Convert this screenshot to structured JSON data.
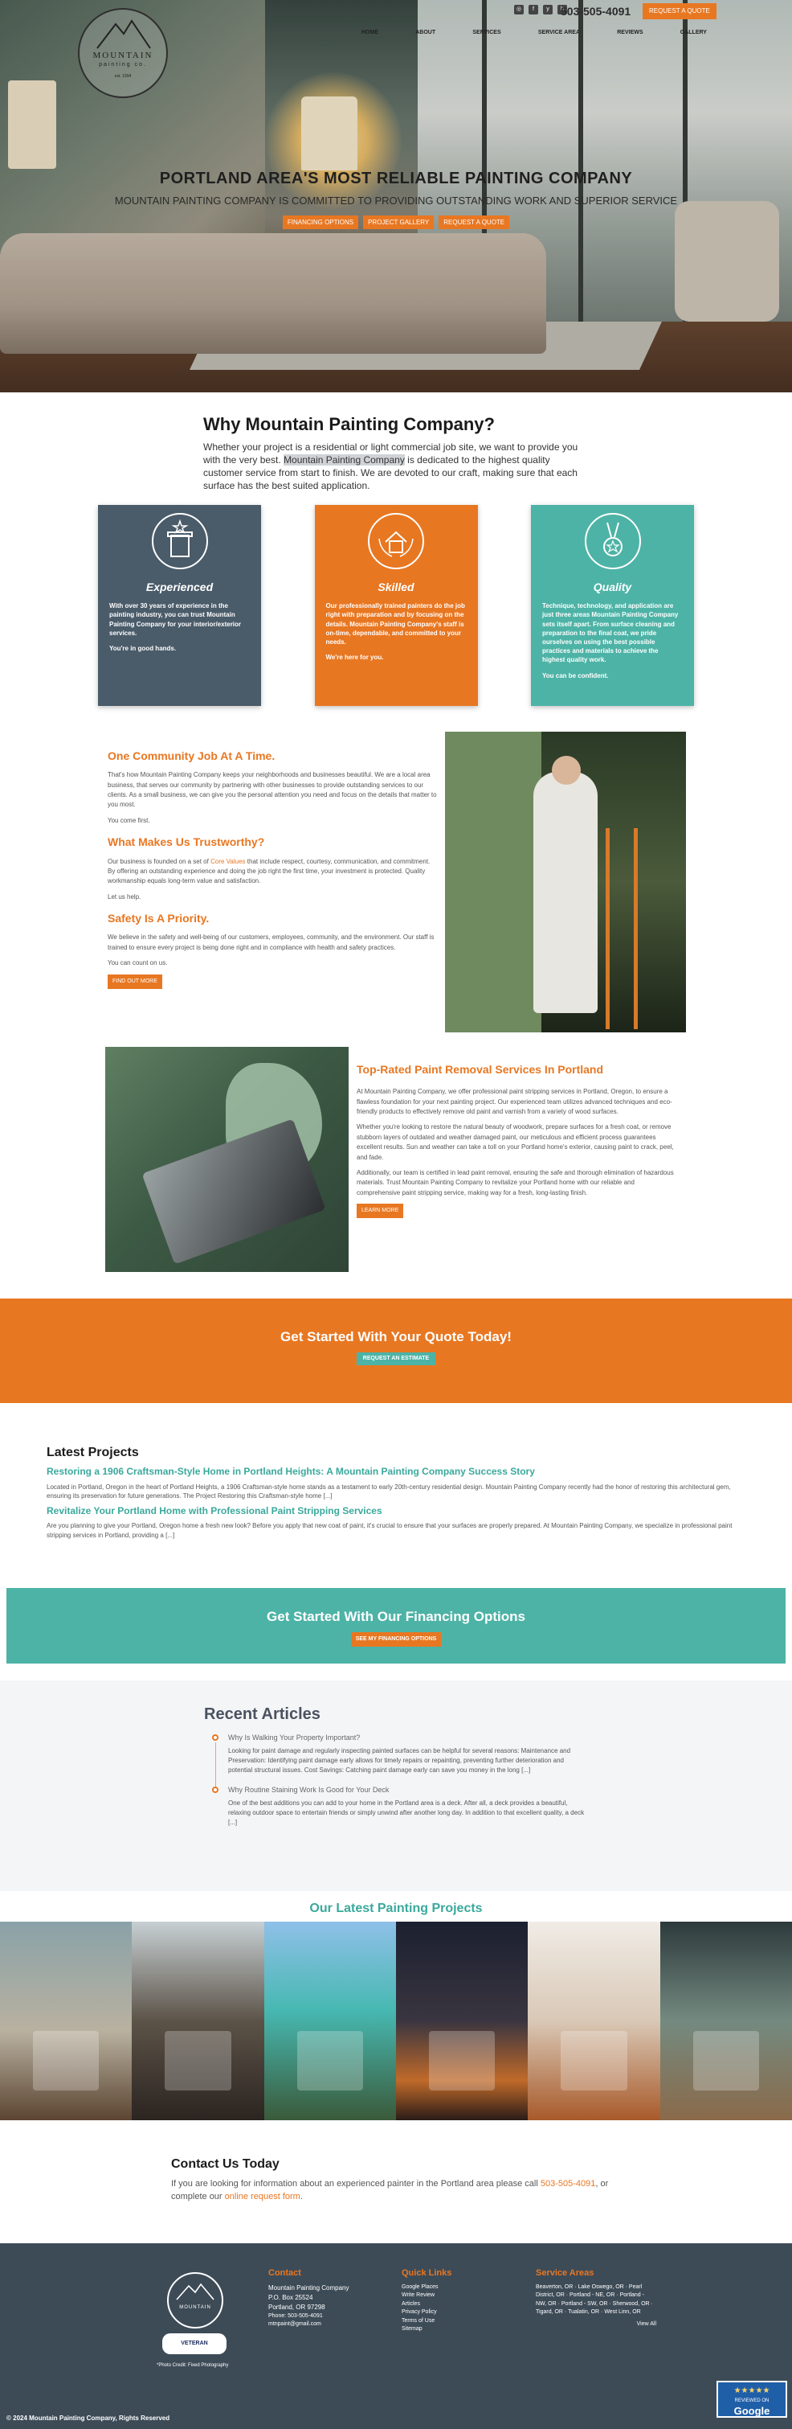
{
  "header": {
    "logo_name": "MOUNTAIN",
    "logo_sub": "painting co.",
    "logo_est": "est. 1994",
    "phone": "503-505-4091",
    "quote_button": "REQUEST A QUOTE",
    "social": [
      "instagram-icon",
      "facebook-icon",
      "yelp-icon",
      "houzz-icon"
    ],
    "nav": [
      "HOME",
      "ABOUT",
      "SERVICES",
      "SERVICE AREA",
      "REVIEWS",
      "GALLERY"
    ]
  },
  "hero": {
    "title": "PORTLAND AREA'S MOST RELIABLE PAINTING COMPANY",
    "subtitle": "MOUNTAIN PAINTING COMPANY IS COMMITTED TO PROVIDING OUTSTANDING WORK AND SUPERIOR SERVICE",
    "buttons": [
      "FINANCING OPTIONS",
      "PROJECT GALLERY",
      "REQUEST A QUOTE"
    ]
  },
  "why": {
    "title": "Why Mountain Painting Company?",
    "text_before": "Whether your project is a residential or light commercial job site, we want to provide you with the very best.",
    "highlight": "Mountain Painting Company",
    "text_after": "is dedicated to the highest quality customer service from start to finish. We are devoted to our craft, making sure that each surface has the best suited application."
  },
  "cards": [
    {
      "title": "Experienced",
      "icon": "pillar-icon",
      "p1": "With over 30 years of experience in the painting industry, you can trust Mountain Painting Company for your interior/exterior services.",
      "p2": "You're in good hands."
    },
    {
      "title": "Skilled",
      "icon": "house-laurel-icon",
      "p1": "Our professionally trained painters do the job right with preparation and by focusing on the details. Mountain Painting Company's staff is on-time, dependable, and committed to your needs.",
      "p2": "We're here for you."
    },
    {
      "title": "Quality",
      "icon": "medal-icon",
      "p1": "Technique, technology, and application are just three areas Mountain Painting Company sets itself apart. From surface cleaning and preparation to the final coat, we pride ourselves on using the best possible practices and materials to achieve the highest quality work.",
      "p2": "You can be confident."
    }
  ],
  "community": {
    "h1": "One Community Job At A Time.",
    "p1": "That's how Mountain Painting Company keeps your neighborhoods and businesses beautiful. We are a local area business, that serves our community by partnering with other businesses to provide outstanding services to our clients. As a small business, we can give you the personal attention you need and focus on the details that matter to you most.",
    "p1b": "You come first.",
    "h2": "What Makes Us Trustworthy?",
    "p2_before": "Our business is founded on a set of",
    "p2_link": "Core Values",
    "p2_after": "that include respect, courtesy, communication, and commitment. By offering an outstanding experience and doing the job right the first time, your investment is protected. Quality workmanship equals long-term value and satisfaction.",
    "p2b": "Let us help.",
    "h3": "Safety Is A Priority.",
    "p3": "We believe in the safety and well-being of our customers, employees, community, and the environment. Our staff is trained to ensure every project is being done right and in compliance with health and safety practices.",
    "p3b": "You can count on us.",
    "button": "FIND OUT MORE"
  },
  "removal": {
    "title": "Top-Rated Paint Removal Services In Portland",
    "p1": "At Mountain Painting Company, we offer professional paint stripping services in Portland, Oregon, to ensure a flawless foundation for your next painting project. Our experienced team utilizes advanced techniques and eco-friendly products to effectively remove old paint and varnish from a variety of wood surfaces.",
    "p2": "Whether you're looking to restore the natural beauty of woodwork, prepare surfaces for a fresh coat, or remove stubborn layers of outdated and weather damaged paint, our meticulous and efficient process guarantees excellent results. Sun and weather can take a toll on your Portland home's exterior, causing paint to crack, peel, and fade.",
    "p3": "Additionally, our team is certified in lead paint removal, ensuring the safe and thorough elimination of hazardous materials. Trust Mountain Painting Company to revitalize your Portland home with our reliable and comprehensive paint stripping service, making way for a fresh, long-lasting finish.",
    "button": "LEARN MORE"
  },
  "quote_band": {
    "title": "Get Started With Your Quote Today!",
    "button": "REQUEST AN ESTIMATE"
  },
  "latest": {
    "title": "Latest Projects",
    "items": [
      {
        "title": "Restoring a 1906 Craftsman-Style Home in Portland Heights: A Mountain Painting Company Success Story",
        "text": "Located in Portland, Oregon in the heart of Portland Heights, a 1906 Craftsman-style home stands as a testament to early 20th-century residential design. Mountain Painting Company recently had the honor of restoring this architectural gem, ensuring its preservation for future generations. The Project Restoring this Craftsman-style home [...]"
      },
      {
        "title": "Revitalize Your Portland Home with Professional Paint Stripping Services",
        "text": "Are you planning to give your Portland, Oregon home a fresh new look? Before you apply that new coat of paint, it's crucial to ensure that your surfaces are properly prepared. At Mountain Painting Company, we specialize in professional paint stripping services in Portland, providing a [...]"
      }
    ]
  },
  "financing": {
    "title": "Get Started With Our Financing Options",
    "button": "SEE MY FINANCING OPTIONS"
  },
  "recent": {
    "title": "Recent Articles",
    "items": [
      {
        "title": "Why Is Walking Your Property Important?",
        "text": "Looking for paint damage and regularly inspecting painted surfaces can be helpful for several reasons: Maintenance and Preservation: Identifying paint damage early allows for timely repairs or repainting, preventing further deterioration and potential structural issues. Cost Savings: Catching paint damage early can save you money in the long [...]"
      },
      {
        "title": "Why Routine Staining Work Is Good for Your Deck",
        "text": "One of the best additions you can add to your home in the Portland area is a deck. After all, a deck provides a beautiful, relaxing outdoor space to entertain friends or simply unwind after another long day. In addition to that excellent quality, a deck [...]"
      }
    ]
  },
  "gallery_title": "Our Latest Painting Projects",
  "contact": {
    "title": "Contact Us Today",
    "text1": "If you are looking for information about an experienced painter in the Portland area please call",
    "phone": "503-505-4091",
    "text2": ", or complete our",
    "link": "online request form",
    "text3": "."
  },
  "footer": {
    "logo_name": "MOUNTAIN",
    "veteran": "VETERAN",
    "photo_credit": "*Photo Credit: Fixed Photography",
    "contact_h": "Contact",
    "contact": [
      "Mountain Painting Company",
      "P.O. Box 25524",
      "Portland, OR 97298",
      "Phone: 503-505-4091",
      "mtnpaint@gmail.com"
    ],
    "links_h": "Quick Links",
    "links": [
      "Google Places",
      "Write Review",
      "Articles",
      "Privacy Policy",
      "Terms of Use",
      "Sitemap"
    ],
    "areas_h": "Service Areas",
    "areas": "Beaverton, OR · Lake Oswego, OR · Pearl District, OR · Portland - NE, OR · Portland - NW, OR · Portland - SW, OR · Sherwood, OR · Tigard, OR · Tualatin, OR · West Linn, OR",
    "view_all": "View All",
    "copyright": "© 2024 Mountain Painting Company, Rights Reserved"
  },
  "google_badge": {
    "stars": "★★★★★",
    "caption": "REVIEWED ON",
    "name": "Google"
  }
}
